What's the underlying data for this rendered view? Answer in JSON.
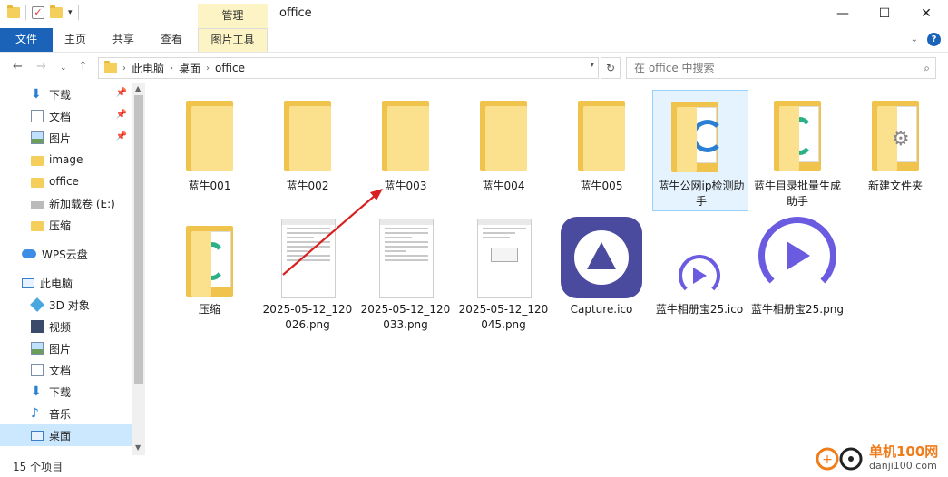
{
  "window": {
    "title": "office",
    "manage_tab": "管理",
    "minimize": "—",
    "maximize": "☐",
    "close": "✕"
  },
  "ribbon": {
    "tabs": [
      "文件",
      "主页",
      "共享",
      "查看",
      "图片工具"
    ]
  },
  "address": {
    "crumbs": [
      "此电脑",
      "桌面",
      "office"
    ],
    "search_placeholder": "在 office 中搜索"
  },
  "sidebar": {
    "items": [
      {
        "label": "下载",
        "icon": "download-icon",
        "pinned": true
      },
      {
        "label": "文档",
        "icon": "document-icon",
        "pinned": true
      },
      {
        "label": "图片",
        "icon": "picture-icon",
        "pinned": true
      },
      {
        "label": "image",
        "icon": "folder-icon",
        "pinned": false
      },
      {
        "label": "office",
        "icon": "folder-icon",
        "pinned": false
      },
      {
        "label": "新加载卷 (E:)",
        "icon": "drive-icon",
        "pinned": false
      },
      {
        "label": "压缩",
        "icon": "folder-icon",
        "pinned": false
      },
      {
        "label": "WPS云盘",
        "icon": "cloud-icon",
        "pinned": false
      },
      {
        "label": "此电脑",
        "icon": "computer-icon",
        "pinned": false
      },
      {
        "label": "3D 对象",
        "icon": "cube-icon",
        "pinned": false
      },
      {
        "label": "视频",
        "icon": "video-icon",
        "pinned": false
      },
      {
        "label": "图片",
        "icon": "picture-icon",
        "pinned": false
      },
      {
        "label": "文档",
        "icon": "document-icon",
        "pinned": false
      },
      {
        "label": "下载",
        "icon": "download-icon",
        "pinned": false
      },
      {
        "label": "音乐",
        "icon": "music-icon",
        "pinned": false
      },
      {
        "label": "桌面",
        "icon": "desktop-icon",
        "pinned": false,
        "selected": true
      }
    ]
  },
  "files": {
    "row1": [
      "蓝牛001",
      "蓝牛002",
      "蓝牛003",
      "蓝牛004",
      "蓝牛005",
      "蓝牛公网ip检测助手",
      "蓝牛目录批量生成助手",
      "新建文件夹"
    ],
    "row2": [
      "压缩",
      "2025-05-12_120026.png",
      "2025-05-12_120033.png",
      "2025-05-12_120045.png",
      "Capture.ico",
      "蓝牛相册宝25.ico",
      "蓝牛相册宝25.png"
    ]
  },
  "status": {
    "count": "15 个项目"
  },
  "watermark": {
    "title": "单机100网",
    "url": "danji100.com"
  },
  "colors": {
    "file_tab": "#1a63b8",
    "manage_tab": "#fcf4c4",
    "selection": "#cce8ff",
    "arrow": "#d92020"
  }
}
